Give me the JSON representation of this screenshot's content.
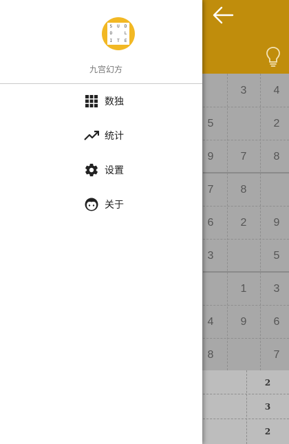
{
  "drawer": {
    "app_name": "九宫幻方",
    "logo_letters": [
      "S",
      "U",
      "D",
      "O",
      "",
      "L",
      "I",
      "T",
      "E"
    ],
    "items": [
      {
        "label": "数独",
        "icon": "grid-icon"
      },
      {
        "label": "统计",
        "icon": "trending-up-icon"
      },
      {
        "label": "设置",
        "icon": "gear-icon"
      },
      {
        "label": "关于",
        "icon": "face-icon"
      }
    ]
  },
  "board": {
    "rows": [
      [
        "",
        "3",
        "4"
      ],
      [
        "5",
        "",
        "2"
      ],
      [
        "9",
        "7",
        "8"
      ],
      [
        "7",
        "8",
        ""
      ],
      [
        "6",
        "2",
        "9"
      ],
      [
        "3",
        "",
        "5"
      ],
      [
        "",
        "1",
        "3"
      ],
      [
        "4",
        "9",
        "6"
      ],
      [
        "8",
        "",
        "7"
      ]
    ]
  },
  "keypad": {
    "keys": [
      "2",
      "3",
      "2"
    ]
  },
  "colors": {
    "appbar": "#c08d0c",
    "logo": "#f2b824",
    "overlay_grid": "#a8a8a8"
  }
}
